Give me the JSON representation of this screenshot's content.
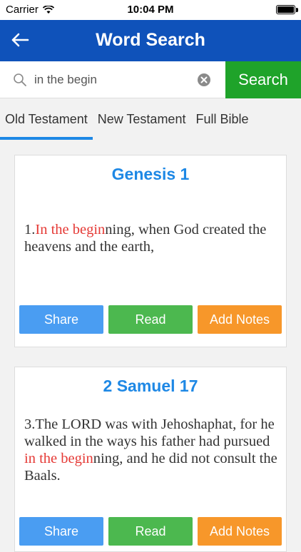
{
  "status_bar": {
    "carrier": "Carrier",
    "time": "10:04 PM",
    "battery_level": 1.0
  },
  "header": {
    "title": "Word Search",
    "back_icon": "arrow-left-icon"
  },
  "search": {
    "query": "in the begin",
    "placeholder": "",
    "button_label": "Search"
  },
  "tabs": [
    {
      "label": "Old Testament",
      "active": true
    },
    {
      "label": "New Testament",
      "active": false
    },
    {
      "label": "Full Bible",
      "active": false
    }
  ],
  "results": [
    {
      "reference": "Genesis 1",
      "number": "1.",
      "before": "",
      "match": "In the begin",
      "after": "ning, when God created the heavens and the earth,"
    },
    {
      "reference": "2 Samuel  17",
      "number": "3.",
      "before": "The LORD was with Jehoshaphat, for he walked in the ways his father had pursued ",
      "match": "in the begin",
      "after": "ning, and he did not consult the Baals."
    }
  ],
  "actions": {
    "share": "Share",
    "read": "Read",
    "add_notes": "Add Notes"
  },
  "colors": {
    "header": "#0f52ba",
    "search_button": "#1fa32a",
    "highlight": "#e53935",
    "title": "#1e88e5",
    "share": "#4a9df2",
    "read": "#4cb84f",
    "notes": "#f7972a"
  }
}
